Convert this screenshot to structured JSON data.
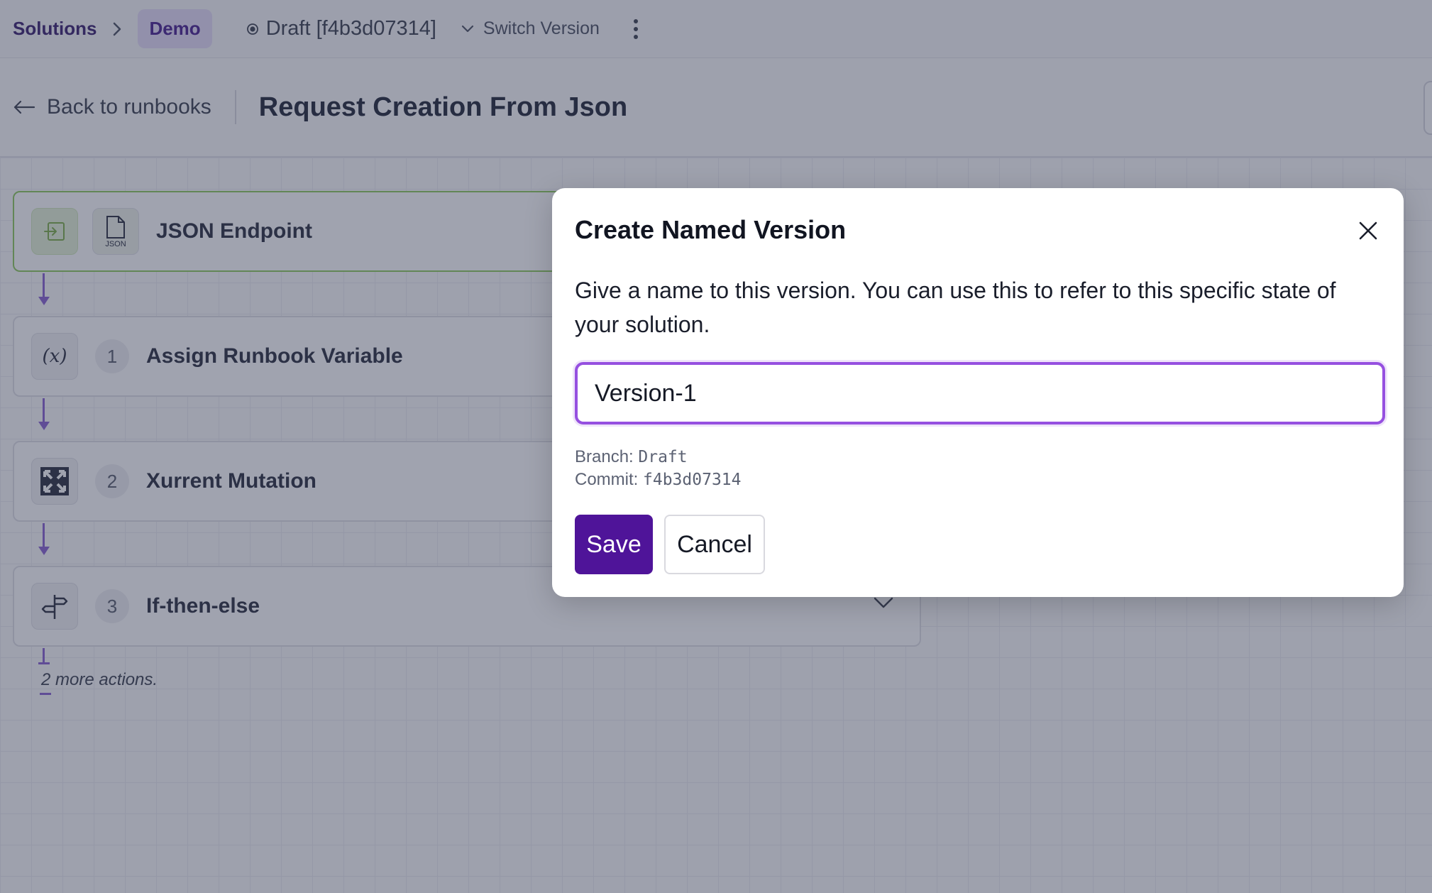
{
  "breadcrumb": {
    "solutions_label": "Solutions",
    "current_label": "Demo"
  },
  "version_bar": {
    "draft_label": "Draft [f4b3d07314]",
    "switch_label": "Switch Version"
  },
  "header": {
    "back_label": "Back to runbooks",
    "title": "Request Creation From Json"
  },
  "flow": {
    "trigger": {
      "label": "JSON Endpoint",
      "icon": "json-file-icon"
    },
    "steps": [
      {
        "number": "1",
        "label": "Assign Runbook Variable",
        "icon": "variable-icon"
      },
      {
        "number": "2",
        "label": "Xurrent Mutation",
        "icon": "xurrent-logo-icon"
      },
      {
        "number": "3",
        "label": "If-then-else",
        "icon": "signpost-icon"
      }
    ],
    "more_actions": "2 more actions."
  },
  "modal": {
    "title": "Create Named Version",
    "description": "Give a name to this version. You can use this to refer to this specific state of your solution.",
    "input_value": "Version-1",
    "branch_label": "Branch:",
    "branch_value": "Draft",
    "commit_label": "Commit:",
    "commit_value": "f4b3d07314",
    "save_label": "Save",
    "cancel_label": "Cancel"
  },
  "colors": {
    "accent": "#4f1499",
    "input_focus": "#9650e0",
    "trigger_border": "#8ecb5e",
    "connector": "#8a63d2"
  }
}
